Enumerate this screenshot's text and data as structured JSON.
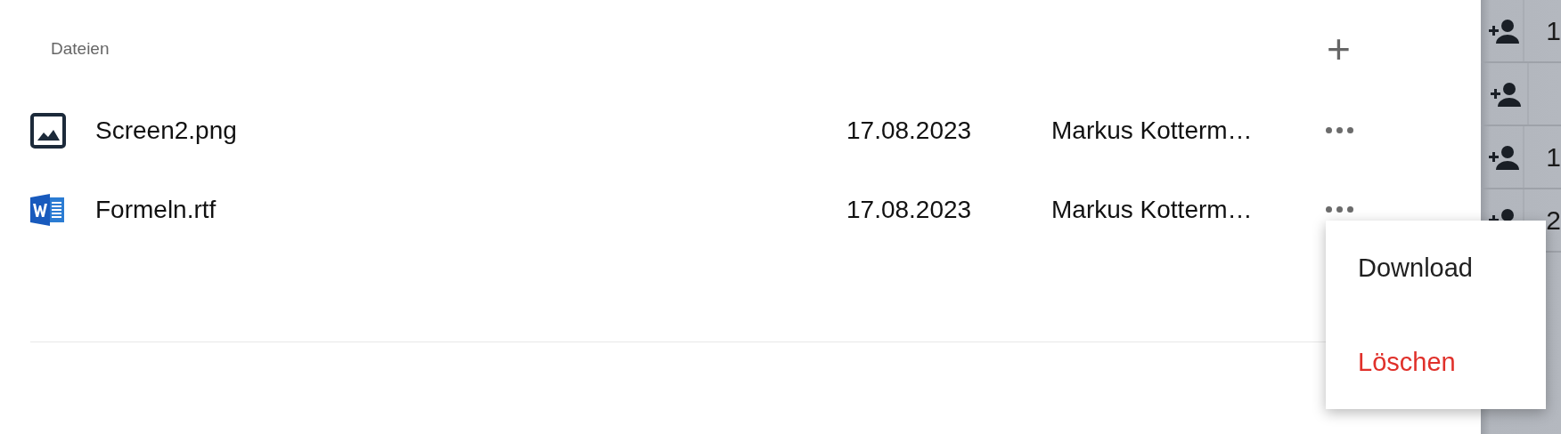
{
  "files_section": {
    "title": "Dateien",
    "add_button": "+",
    "files": [
      {
        "kind": "image",
        "name": "Screen2.png",
        "date": "17.08.2023",
        "owner": "Markus Kotterm…",
        "menu_open": false
      },
      {
        "kind": "word",
        "name": "Formeln.rtf",
        "date": "17.08.2023",
        "owner": "Markus Kotterm…",
        "menu_open": true
      }
    ],
    "menu": [
      {
        "kind": "normal",
        "label": "Download"
      },
      {
        "kind": "danger",
        "label": "Löschen"
      }
    ]
  },
  "side_panel": {
    "rows": [
      {
        "count": "1"
      },
      {},
      {
        "count": "1"
      },
      {
        "count": "2"
      }
    ]
  }
}
